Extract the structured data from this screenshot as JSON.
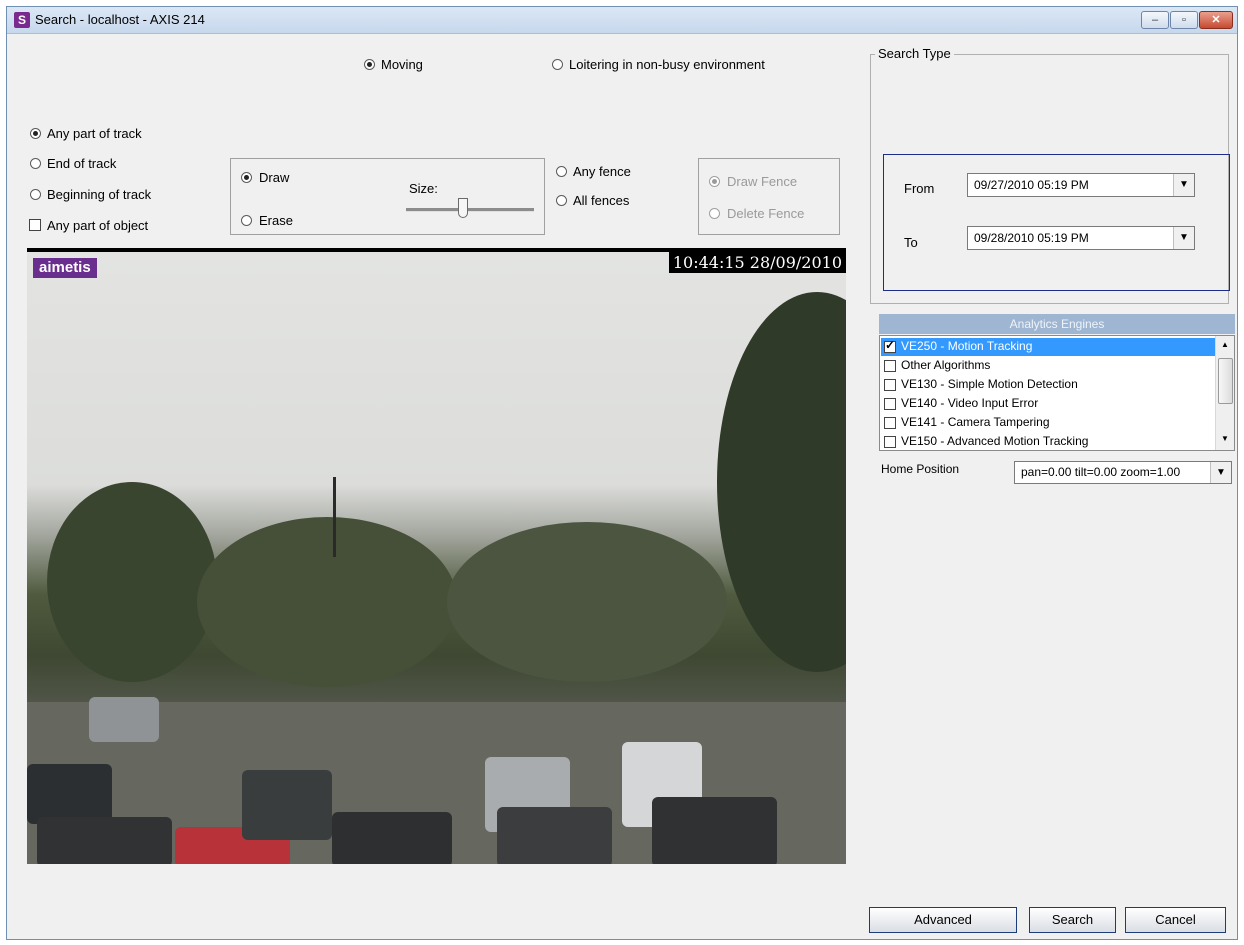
{
  "window": {
    "title": "Search - localhost - AXIS 214",
    "app_icon": "S",
    "controls": {
      "minimize": "–",
      "maximize": "▫",
      "close": "✕"
    }
  },
  "mode": {
    "moving": {
      "label": "Moving",
      "selected": true
    },
    "loitering": {
      "label": "Loitering in non-busy environment",
      "selected": false
    }
  },
  "track": {
    "options": [
      {
        "label": "Any part of track",
        "selected": true
      },
      {
        "label": "End of track",
        "selected": false
      },
      {
        "label": "Beginning of track",
        "selected": false
      }
    ],
    "any_part_of_object": {
      "label": "Any part of object",
      "checked": false
    }
  },
  "draw": {
    "draw": {
      "label": "Draw",
      "selected": true
    },
    "erase": {
      "label": "Erase",
      "selected": false
    },
    "size_label": "Size:"
  },
  "fence": {
    "any_fence": {
      "label": "Any fence",
      "selected": false
    },
    "all_fences": {
      "label": "All fences",
      "selected": false
    },
    "draw_fence": {
      "label": "Draw Fence",
      "selected": true,
      "disabled": true
    },
    "delete_fence": {
      "label": "Delete Fence",
      "selected": false,
      "disabled": true
    }
  },
  "video": {
    "logo": "aimetis",
    "timestamp": "10:44:15 28/09/2010"
  },
  "search_type": {
    "title": "Search Type",
    "from_label": "From",
    "from_value": "09/27/2010 05:19 PM",
    "to_label": "To",
    "to_value": "09/28/2010 05:19 PM"
  },
  "analytics": {
    "header": "Analytics Engines",
    "items": [
      {
        "label": "VE250 - Motion Tracking",
        "checked": true,
        "selected": true
      },
      {
        "label": "Other Algorithms",
        "checked": false,
        "selected": false
      },
      {
        "label": "VE130 - Simple Motion Detection",
        "checked": false,
        "selected": false
      },
      {
        "label": "VE140 - Video Input Error",
        "checked": false,
        "selected": false
      },
      {
        "label": "VE141 - Camera Tampering",
        "checked": false,
        "selected": false
      },
      {
        "label": "VE150 - Advanced Motion Tracking",
        "checked": false,
        "selected": false
      }
    ]
  },
  "home_position": {
    "label": "Home Position",
    "value": "pan=0.00 tilt=0.00 zoom=1.00"
  },
  "buttons": {
    "advanced": "Advanced",
    "search": "Search",
    "cancel": "Cancel"
  },
  "colors": {
    "selection": "#3399ff",
    "list_header": "#9fb6d2",
    "search_frame_border": "#1c2d8a"
  }
}
